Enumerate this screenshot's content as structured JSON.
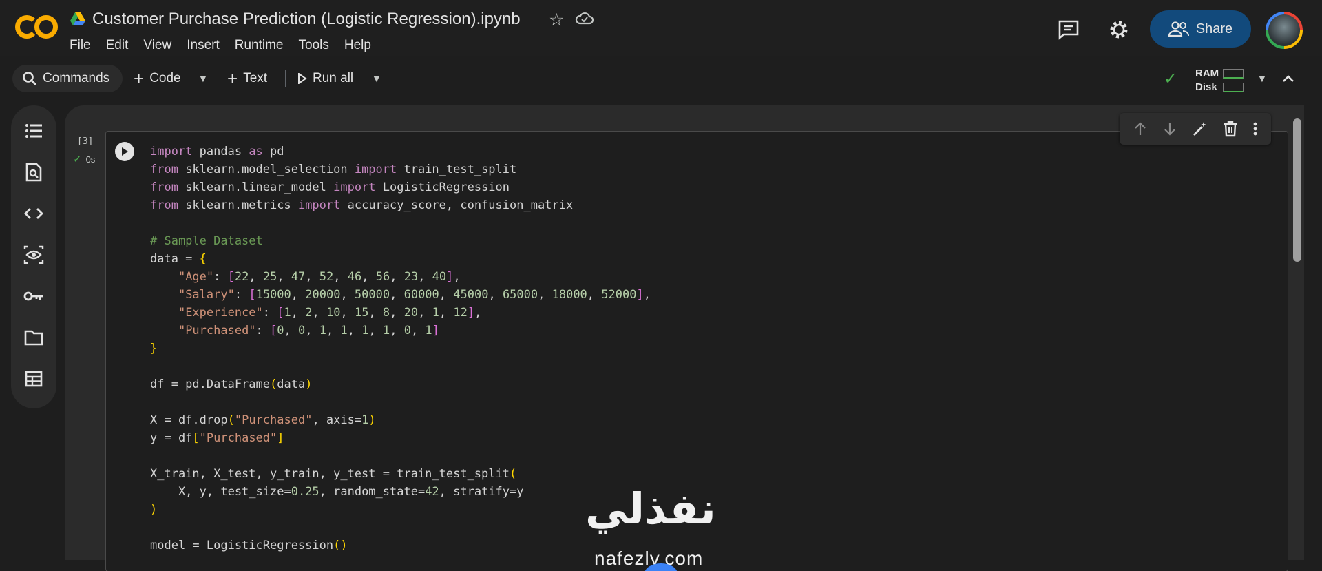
{
  "header": {
    "title": "Customer Purchase Prediction (Logistic Regression).ipynb",
    "menu": [
      "File",
      "Edit",
      "View",
      "Insert",
      "Runtime",
      "Tools",
      "Help"
    ],
    "share_label": "Share",
    "logo_text": "CO"
  },
  "toolbar": {
    "commands_label": "Commands",
    "code_label": "Code",
    "text_label": "Text",
    "run_all_label": "Run all",
    "ram_label": "RAM",
    "disk_label": "Disk"
  },
  "cell": {
    "execution_count": "[3]",
    "exec_time": "0s"
  },
  "watermark": {
    "arabic": "نفذلي",
    "latin": "nafezly.com"
  },
  "icons": {
    "rail": [
      "table-of-contents-icon",
      "find-icon",
      "code-snippets-icon",
      "variables-icon",
      "secrets-key-icon",
      "files-icon",
      "data-table-icon"
    ]
  }
}
